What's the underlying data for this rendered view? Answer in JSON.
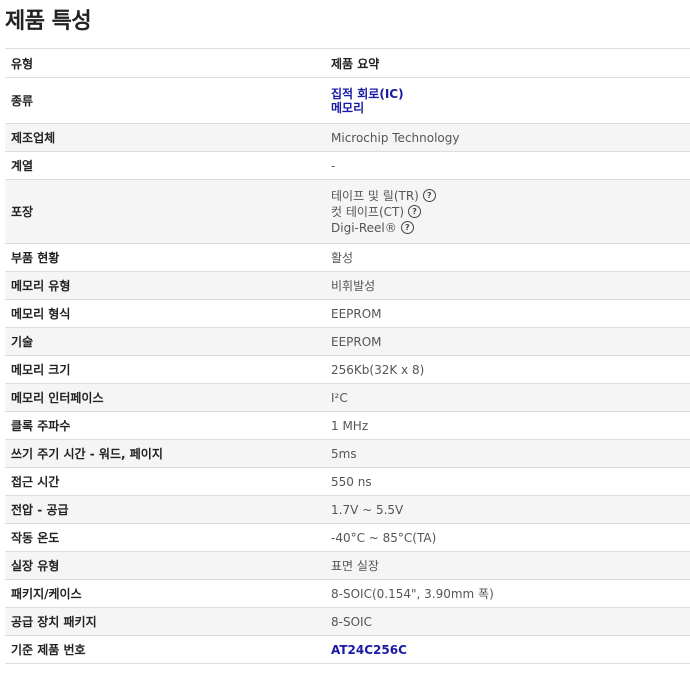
{
  "title": "제품 특성",
  "table": {
    "header": {
      "label": "유형",
      "value": "제품 요약"
    },
    "category": {
      "label": "종류",
      "links": [
        "집적 회로(IC)",
        "메모리"
      ]
    },
    "manufacturer": {
      "label": "제조업체",
      "value": "Microchip Technology"
    },
    "series": {
      "label": "계열",
      "value": "-"
    },
    "packaging": {
      "label": "포장",
      "options": [
        "테이프 및 릴(TR)",
        "컷 테이프(CT)",
        "Digi-Reel®"
      ],
      "help_icon": "?"
    },
    "rows": [
      {
        "label": "부품 현황",
        "value": "활성"
      },
      {
        "label": "메모리 유형",
        "value": "비휘발성"
      },
      {
        "label": "메모리 형식",
        "value": "EEPROM"
      },
      {
        "label": "기술",
        "value": "EEPROM"
      },
      {
        "label": "메모리 크기",
        "value": "256Kb(32K x 8)"
      },
      {
        "label": "메모리 인터페이스",
        "value": "I²C"
      },
      {
        "label": "클록 주파수",
        "value": "1 MHz"
      },
      {
        "label": "쓰기 주기 시간 - 워드, 페이지",
        "value": "5ms"
      },
      {
        "label": "접근 시간",
        "value": "550 ns"
      },
      {
        "label": "전압 - 공급",
        "value": "1.7V ~ 5.5V"
      },
      {
        "label": "작동 온도",
        "value": "-40°C ~ 85°C(TA)"
      },
      {
        "label": "실장 유형",
        "value": "표면 실장"
      },
      {
        "label": "패키지/케이스",
        "value": "8-SOIC(0.154\", 3.90mm 폭)"
      },
      {
        "label": "공급 장치 패키지",
        "value": "8-SOIC"
      }
    ],
    "base_part": {
      "label": "기준 제품 번호",
      "value": "AT24C256C"
    }
  },
  "colors": {
    "link": "#1a1aa6",
    "stripe": "#f5f5f5",
    "border": "#dddddd"
  }
}
